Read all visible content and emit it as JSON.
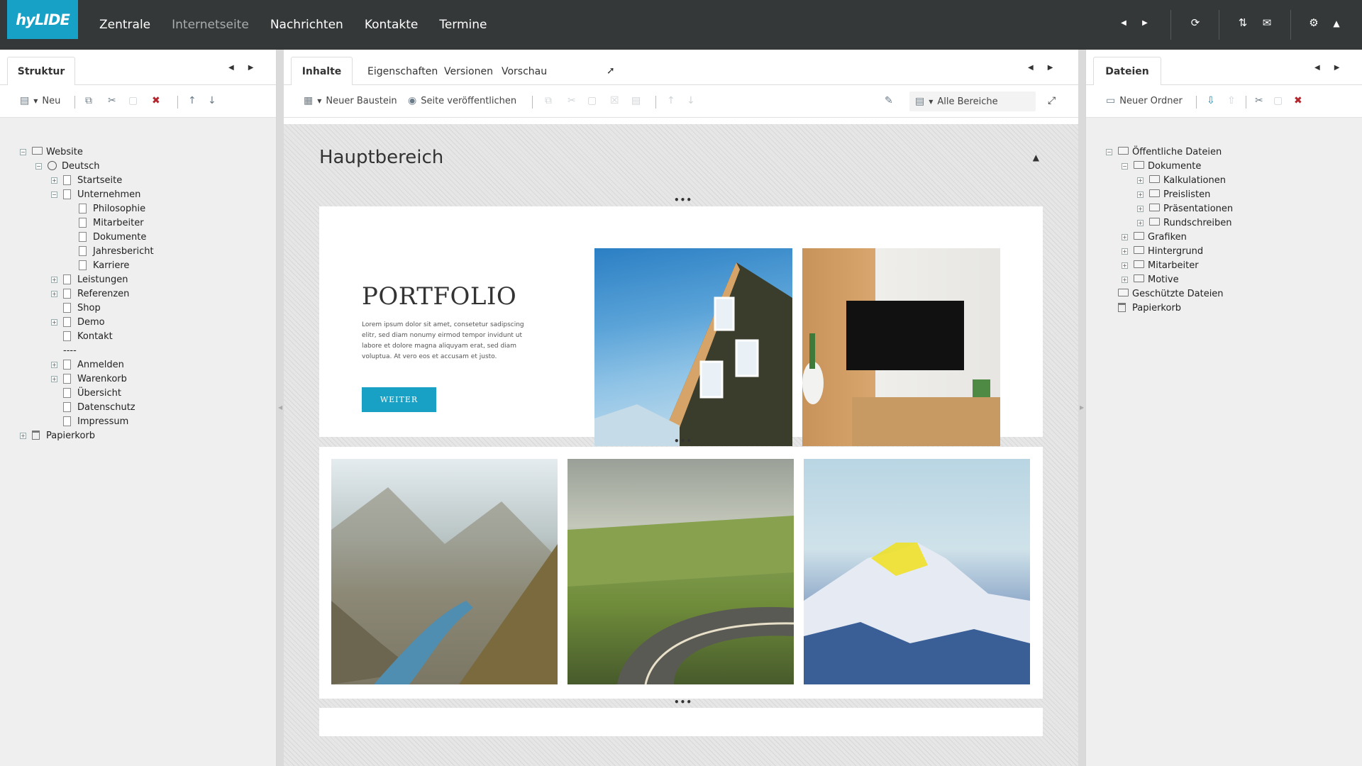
{
  "topbar": {
    "logo": "hyLIDE",
    "nav": [
      "Zentrale",
      "Internetseite",
      "Nachrichten",
      "Kontakte",
      "Termine"
    ],
    "icons": [
      "arrow-left-icon",
      "arrow-right-icon",
      "sync-icon",
      "transfer-icon",
      "mail-icon",
      "gear-icon",
      "chevron-up-icon"
    ]
  },
  "left": {
    "tab": "Struktur",
    "toolbar": {
      "new": "Neu"
    },
    "tree": [
      {
        "label": "Website",
        "level": 0,
        "expander": "−",
        "icon": "folder"
      },
      {
        "label": "Deutsch",
        "level": 1,
        "expander": "−",
        "icon": "globe"
      },
      {
        "label": "Startseite",
        "level": 2,
        "expander": "+",
        "icon": "page"
      },
      {
        "label": "Unternehmen",
        "level": 2,
        "expander": "−",
        "icon": "page"
      },
      {
        "label": "Philosophie",
        "level": 3,
        "expander": "",
        "icon": "page"
      },
      {
        "label": "Mitarbeiter",
        "level": 3,
        "expander": "",
        "icon": "page"
      },
      {
        "label": "Dokumente",
        "level": 3,
        "expander": "",
        "icon": "page"
      },
      {
        "label": "Jahresbericht",
        "level": 3,
        "expander": "",
        "icon": "page"
      },
      {
        "label": "Karriere",
        "level": 3,
        "expander": "",
        "icon": "page"
      },
      {
        "label": "Leistungen",
        "level": 2,
        "expander": "+",
        "icon": "page"
      },
      {
        "label": "Referenzen",
        "level": 2,
        "expander": "+",
        "icon": "page"
      },
      {
        "label": "Shop",
        "level": 2,
        "expander": "",
        "icon": "page"
      },
      {
        "label": "Demo",
        "level": 2,
        "expander": "+",
        "icon": "page"
      },
      {
        "label": "Kontakt",
        "level": 2,
        "expander": "",
        "icon": "page"
      },
      {
        "label": "----",
        "level": 2,
        "expander": "",
        "icon": "none"
      },
      {
        "label": "Anmelden",
        "level": 2,
        "expander": "+",
        "icon": "page"
      },
      {
        "label": "Warenkorb",
        "level": 2,
        "expander": "+",
        "icon": "page"
      },
      {
        "label": "Übersicht",
        "level": 2,
        "expander": "",
        "icon": "page"
      },
      {
        "label": "Datenschutz",
        "level": 2,
        "expander": "",
        "icon": "page"
      },
      {
        "label": "Impressum",
        "level": 2,
        "expander": "",
        "icon": "page"
      },
      {
        "label": "Papierkorb",
        "level": 0,
        "expander": "+",
        "icon": "trash"
      }
    ]
  },
  "middle": {
    "tabs": [
      "Inhalte",
      "Eigenschaften",
      "Versionen",
      "Vorschau"
    ],
    "toolbar": {
      "new_block": "Neuer Baustein",
      "publish": "Seite veröffentlichen",
      "areas": "Alle Bereiche"
    },
    "area_title": "Hauptbereich",
    "portfolio": {
      "title": "PORTFOLIO",
      "text": "Lorem ipsum dolor sit amet, consetetur sadipscing elitr, sed diam nonumy eirmod tempor invidunt ut labore et dolore magna aliquyam erat, sed diam voluptua. At vero eos et accusam et justo.",
      "button": "WEITER"
    },
    "dots": "•••"
  },
  "right": {
    "tab": "Dateien",
    "toolbar": {
      "new_folder": "Neuer Ordner"
    },
    "tree": [
      {
        "label": "Öffentliche Dateien",
        "level": 0,
        "expander": "−",
        "icon": "folder"
      },
      {
        "label": "Dokumente",
        "level": 1,
        "expander": "−",
        "icon": "folder"
      },
      {
        "label": "Kalkulationen",
        "level": 2,
        "expander": "+",
        "icon": "folder"
      },
      {
        "label": "Preislisten",
        "level": 2,
        "expander": "+",
        "icon": "folder"
      },
      {
        "label": "Präsentationen",
        "level": 2,
        "expander": "+",
        "icon": "folder"
      },
      {
        "label": "Rundschreiben",
        "level": 2,
        "expander": "+",
        "icon": "folder"
      },
      {
        "label": "Grafiken",
        "level": 1,
        "expander": "+",
        "icon": "folder"
      },
      {
        "label": "Hintergrund",
        "level": 1,
        "expander": "+",
        "icon": "folder"
      },
      {
        "label": "Mitarbeiter",
        "level": 1,
        "expander": "+",
        "icon": "folder"
      },
      {
        "label": "Motive",
        "level": 1,
        "expander": "+",
        "icon": "folder"
      },
      {
        "label": "Geschützte Dateien",
        "level": 0,
        "expander": "",
        "icon": "folder"
      },
      {
        "label": "Papierkorb",
        "level": 0,
        "expander": "",
        "icon": "trash"
      }
    ]
  },
  "colors": {
    "accent": "#17a1c6",
    "topbar": "#343838"
  }
}
